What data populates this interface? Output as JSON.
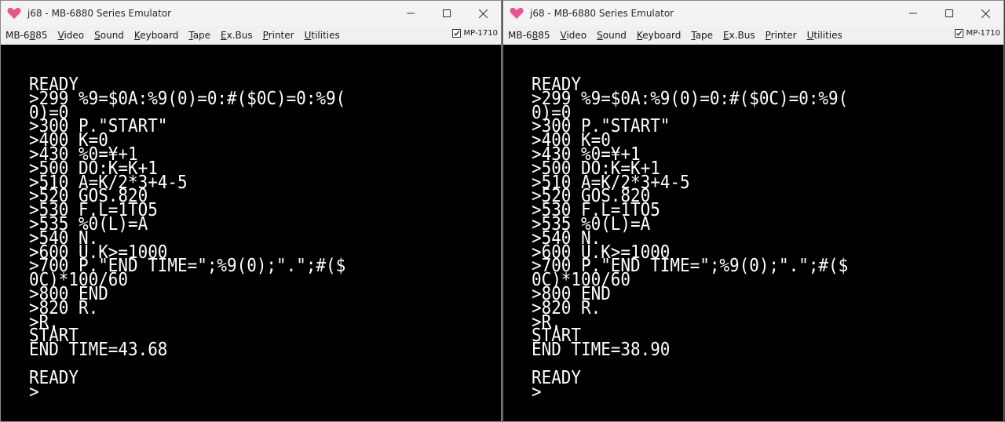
{
  "colors": {
    "screen_bg": "#000000",
    "screen_fg": "#ffffff",
    "titlebar_bg": "#f3f3f3",
    "menubar_bg": "#f0f0f0",
    "icon_pink": "#e8568f"
  },
  "icons": {
    "app": "pink-heart-icon",
    "minimize": "minimize-icon",
    "maximize": "maximize-icon",
    "close": "close-icon",
    "checkbox": "checkmark-icon"
  },
  "windows": [
    {
      "title": "j68 - MB-6880 Series Emulator",
      "menu": [
        {
          "pre": "MB-6",
          "ul": "8",
          "post": "85"
        },
        {
          "pre": "",
          "ul": "V",
          "post": "ideo"
        },
        {
          "pre": "",
          "ul": "S",
          "post": "ound"
        },
        {
          "pre": "",
          "ul": "K",
          "post": "eyboard"
        },
        {
          "pre": "",
          "ul": "T",
          "post": "ape"
        },
        {
          "pre": "",
          "ul": "E",
          "post": "x.Bus"
        },
        {
          "pre": "",
          "ul": "P",
          "post": "rinter"
        },
        {
          "pre": "",
          "ul": "U",
          "post": "tilities"
        }
      ],
      "mp_label": "MP-1710",
      "mp_checked": true,
      "screen_lines": [
        "READY",
        ">299 %9=$0A:%9(0)=0:#($0C)=0:%9(",
        "0)=0",
        ">300 P.\"START\"",
        ">400 K=0",
        ">430 %0=¥+1",
        ">500 DO:K=K+1",
        ">510 A=K/2*3+4-5",
        ">520 GOS.820",
        ">530 F.L=1TO5",
        ">535 %0(L)=A",
        ">540 N.",
        ">600 U.K>=1000",
        ">700 P.\"END TIME=\";%9(0);\".\";#($",
        "0C)*100/60",
        ">800 END",
        ">820 R.",
        ">R.",
        "START",
        "END TIME=43.68",
        "",
        "READY",
        ">"
      ]
    },
    {
      "title": "j68 - MB-6880 Series Emulator",
      "menu": [
        {
          "pre": "MB-6",
          "ul": "8",
          "post": "85"
        },
        {
          "pre": "",
          "ul": "V",
          "post": "ideo"
        },
        {
          "pre": "",
          "ul": "S",
          "post": "ound"
        },
        {
          "pre": "",
          "ul": "K",
          "post": "eyboard"
        },
        {
          "pre": "",
          "ul": "T",
          "post": "ape"
        },
        {
          "pre": "",
          "ul": "E",
          "post": "x.Bus"
        },
        {
          "pre": "",
          "ul": "P",
          "post": "rinter"
        },
        {
          "pre": "",
          "ul": "U",
          "post": "tilities"
        }
      ],
      "mp_label": "MP-1710",
      "mp_checked": true,
      "screen_lines": [
        "READY",
        ">299 %9=$0A:%9(0)=0:#($0C)=0:%9(",
        "0)=0",
        ">300 P.\"START\"",
        ">400 K=0",
        ">430 %0=¥+1",
        ">500 DO:K=K+1",
        ">510 A=K/2*3+4-5",
        ">520 GOS.820",
        ">530 F.L=1TO5",
        ">535 %0(L)=A",
        ">540 N.",
        ">600 U.K>=1000",
        ">700 P.\"END TIME=\";%9(0);\".\";#($",
        "0C)*100/60",
        ">800 END",
        ">820 R.",
        ">R.",
        "START",
        "END TIME=38.90",
        "",
        "READY",
        ">"
      ]
    }
  ]
}
